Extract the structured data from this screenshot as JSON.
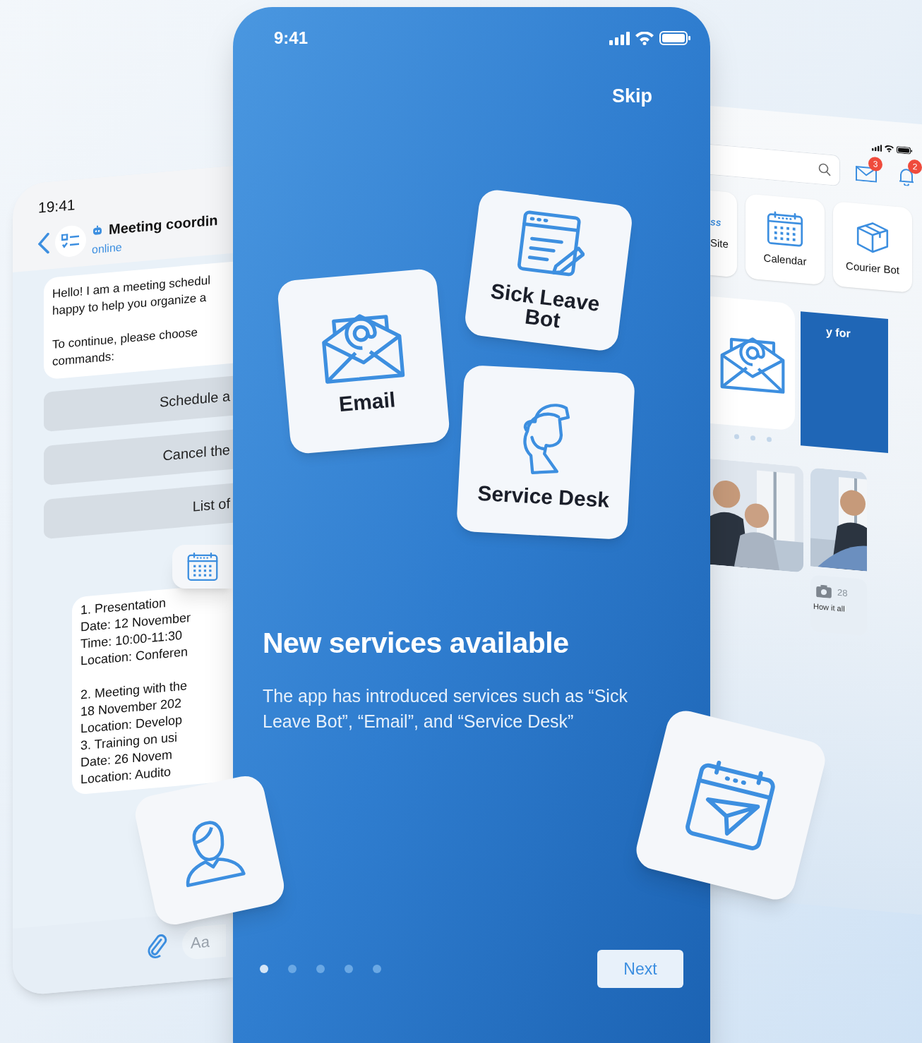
{
  "left_phone": {
    "time": "19:41",
    "chat_title": "Meeting coordin",
    "chat_status": "online",
    "greeting": "Hello! I am a meeting schedul\nhappy to help you organize a\n\nTo continue, please choose\ncommands:",
    "commands": [
      {
        "label": "Schedule a"
      },
      {
        "label": "Cancel the"
      },
      {
        "label": "List of"
      }
    ],
    "schedule": "1. Presentation\nDate: 12 November\nTime: 10:00-11:30\nLocation: Conferen\n\n2. Meeting with the\n18 November 202\nLocation: Develop\n3. Training on usi\nDate: 26 Novem\nLocation: Audito",
    "input": {
      "placeholder": "Aa"
    }
  },
  "center_phone": {
    "time": "9:41",
    "skip": "Skip",
    "services": [
      {
        "kind": "email",
        "label": "Email"
      },
      {
        "kind": "sick",
        "label": "Sick Leave\nBot"
      },
      {
        "kind": "desk",
        "label": "Service Desk"
      }
    ],
    "title": "New services available",
    "description": "The app has introduced services such as “Sick Leave Bot”, “Email”, and “Service Desk”",
    "pager": [
      {
        "selected": true
      },
      {
        "selected": false
      },
      {
        "selected": false
      },
      {
        "selected": false
      },
      {
        "selected": false
      }
    ],
    "next": "Next"
  },
  "right_phone": {
    "mail_badge": "3",
    "bell_badge": "2",
    "tiles": [
      {
        "kind": "site",
        "caption": "ss",
        "label": "Site"
      },
      {
        "kind": "calendar",
        "label": "Calendar"
      },
      {
        "kind": "box",
        "label": "Courier Bot"
      }
    ],
    "banner": "y for",
    "news": {
      "count": "28",
      "title": "How it all"
    }
  },
  "floating_cards": [
    {
      "kind": "calendar"
    },
    {
      "kind": "person"
    },
    {
      "kind": "plane"
    }
  ]
}
